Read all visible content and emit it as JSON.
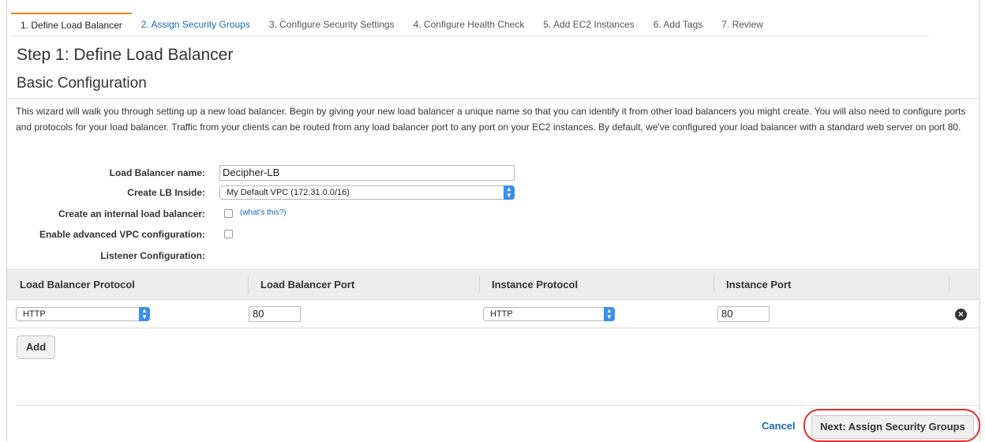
{
  "tabs": [
    {
      "label": "1. Define Load Balancer"
    },
    {
      "label": "2. Assign Security Groups"
    },
    {
      "label": "3. Configure Security Settings"
    },
    {
      "label": "4. Configure Health Check"
    },
    {
      "label": "5. Add EC2 Instances"
    },
    {
      "label": "6. Add Tags"
    },
    {
      "label": "7. Review"
    }
  ],
  "page": {
    "title": "Step 1: Define Load Balancer",
    "section": "Basic Configuration",
    "description": "This wizard will walk you through setting up a new load balancer. Begin by giving your new load balancer a unique name so that you can identify it from other load balancers you might create. You will also need to configure ports and protocols for your load balancer. Traffic from your clients can be routed from any load balancer port to any port on your EC2 instances. By default, we've configured your load balancer with a standard web server on port 80."
  },
  "form": {
    "name_label": "Load Balancer name:",
    "name_value": "Decipher-LB",
    "inside_label": "Create LB Inside:",
    "inside_value": "My Default VPC (172.31.0.0/16)",
    "internal_label": "Create an internal load balancer:",
    "whats_this": "(what's this?)",
    "advanced_label": "Enable advanced VPC configuration:",
    "listener_label": "Listener Configuration:"
  },
  "listener_table": {
    "columns": [
      "Load Balancer Protocol",
      "Load Balancer Port",
      "Instance Protocol",
      "Instance Port"
    ],
    "rows": [
      {
        "lb_protocol": "HTTP",
        "lb_port": "80",
        "instance_protocol": "HTTP",
        "instance_port": "80"
      }
    ]
  },
  "buttons": {
    "add": "Add",
    "cancel": "Cancel",
    "next": "Next: Assign Security Groups"
  },
  "colors": {
    "accent_tab": "#e8840c",
    "link": "#1a6ab8",
    "highlight_ring": "#e0302a",
    "select_chevron": "#3a8ef0"
  },
  "icons": {
    "select_chevron": "chevron-updown-icon",
    "remove_row": "remove-circle-icon"
  }
}
